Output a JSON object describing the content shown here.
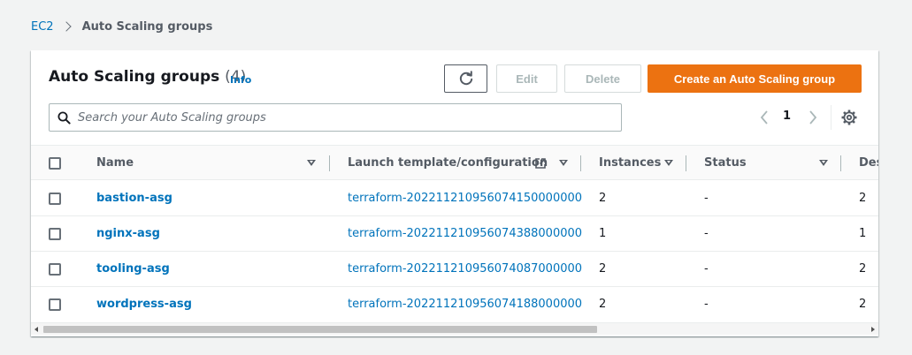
{
  "breadcrumb": {
    "root": "EC2",
    "current": "Auto Scaling groups"
  },
  "header": {
    "title": "Auto Scaling groups",
    "count": "(4)",
    "info": "Info"
  },
  "actions": {
    "edit": "Edit",
    "delete": "Delete",
    "create": "Create an Auto Scaling group"
  },
  "search": {
    "placeholder": "Search your Auto Scaling groups"
  },
  "pagination": {
    "current_page": "1"
  },
  "columns": {
    "name": "Name",
    "launch_template": "Launch template/configuration",
    "instances": "Instances",
    "status": "Status",
    "desired": "Des"
  },
  "rows": [
    {
      "name": "bastion-asg",
      "launch_template": "terraform-20221121095607415000000​0",
      "instances": "2",
      "status": "-",
      "desired": "2"
    },
    {
      "name": "nginx-asg",
      "launch_template": "terraform-20221121095607438800000​0",
      "instances": "1",
      "status": "-",
      "desired": "1"
    },
    {
      "name": "tooling-asg",
      "launch_template": "terraform-20221121095607408700000​0",
      "instances": "2",
      "status": "-",
      "desired": "2"
    },
    {
      "name": "wordpress-asg",
      "launch_template": "terraform-20221121095607418800000​0",
      "instances": "2",
      "status": "-",
      "desired": "2"
    }
  ],
  "colors": {
    "link": "#0073bb",
    "primary": "#ec7211",
    "background": "#f2f3f3"
  },
  "icons": {
    "refresh": "refresh-icon",
    "external": "external-link-icon",
    "search": "search-icon",
    "settings": "gear-icon"
  }
}
